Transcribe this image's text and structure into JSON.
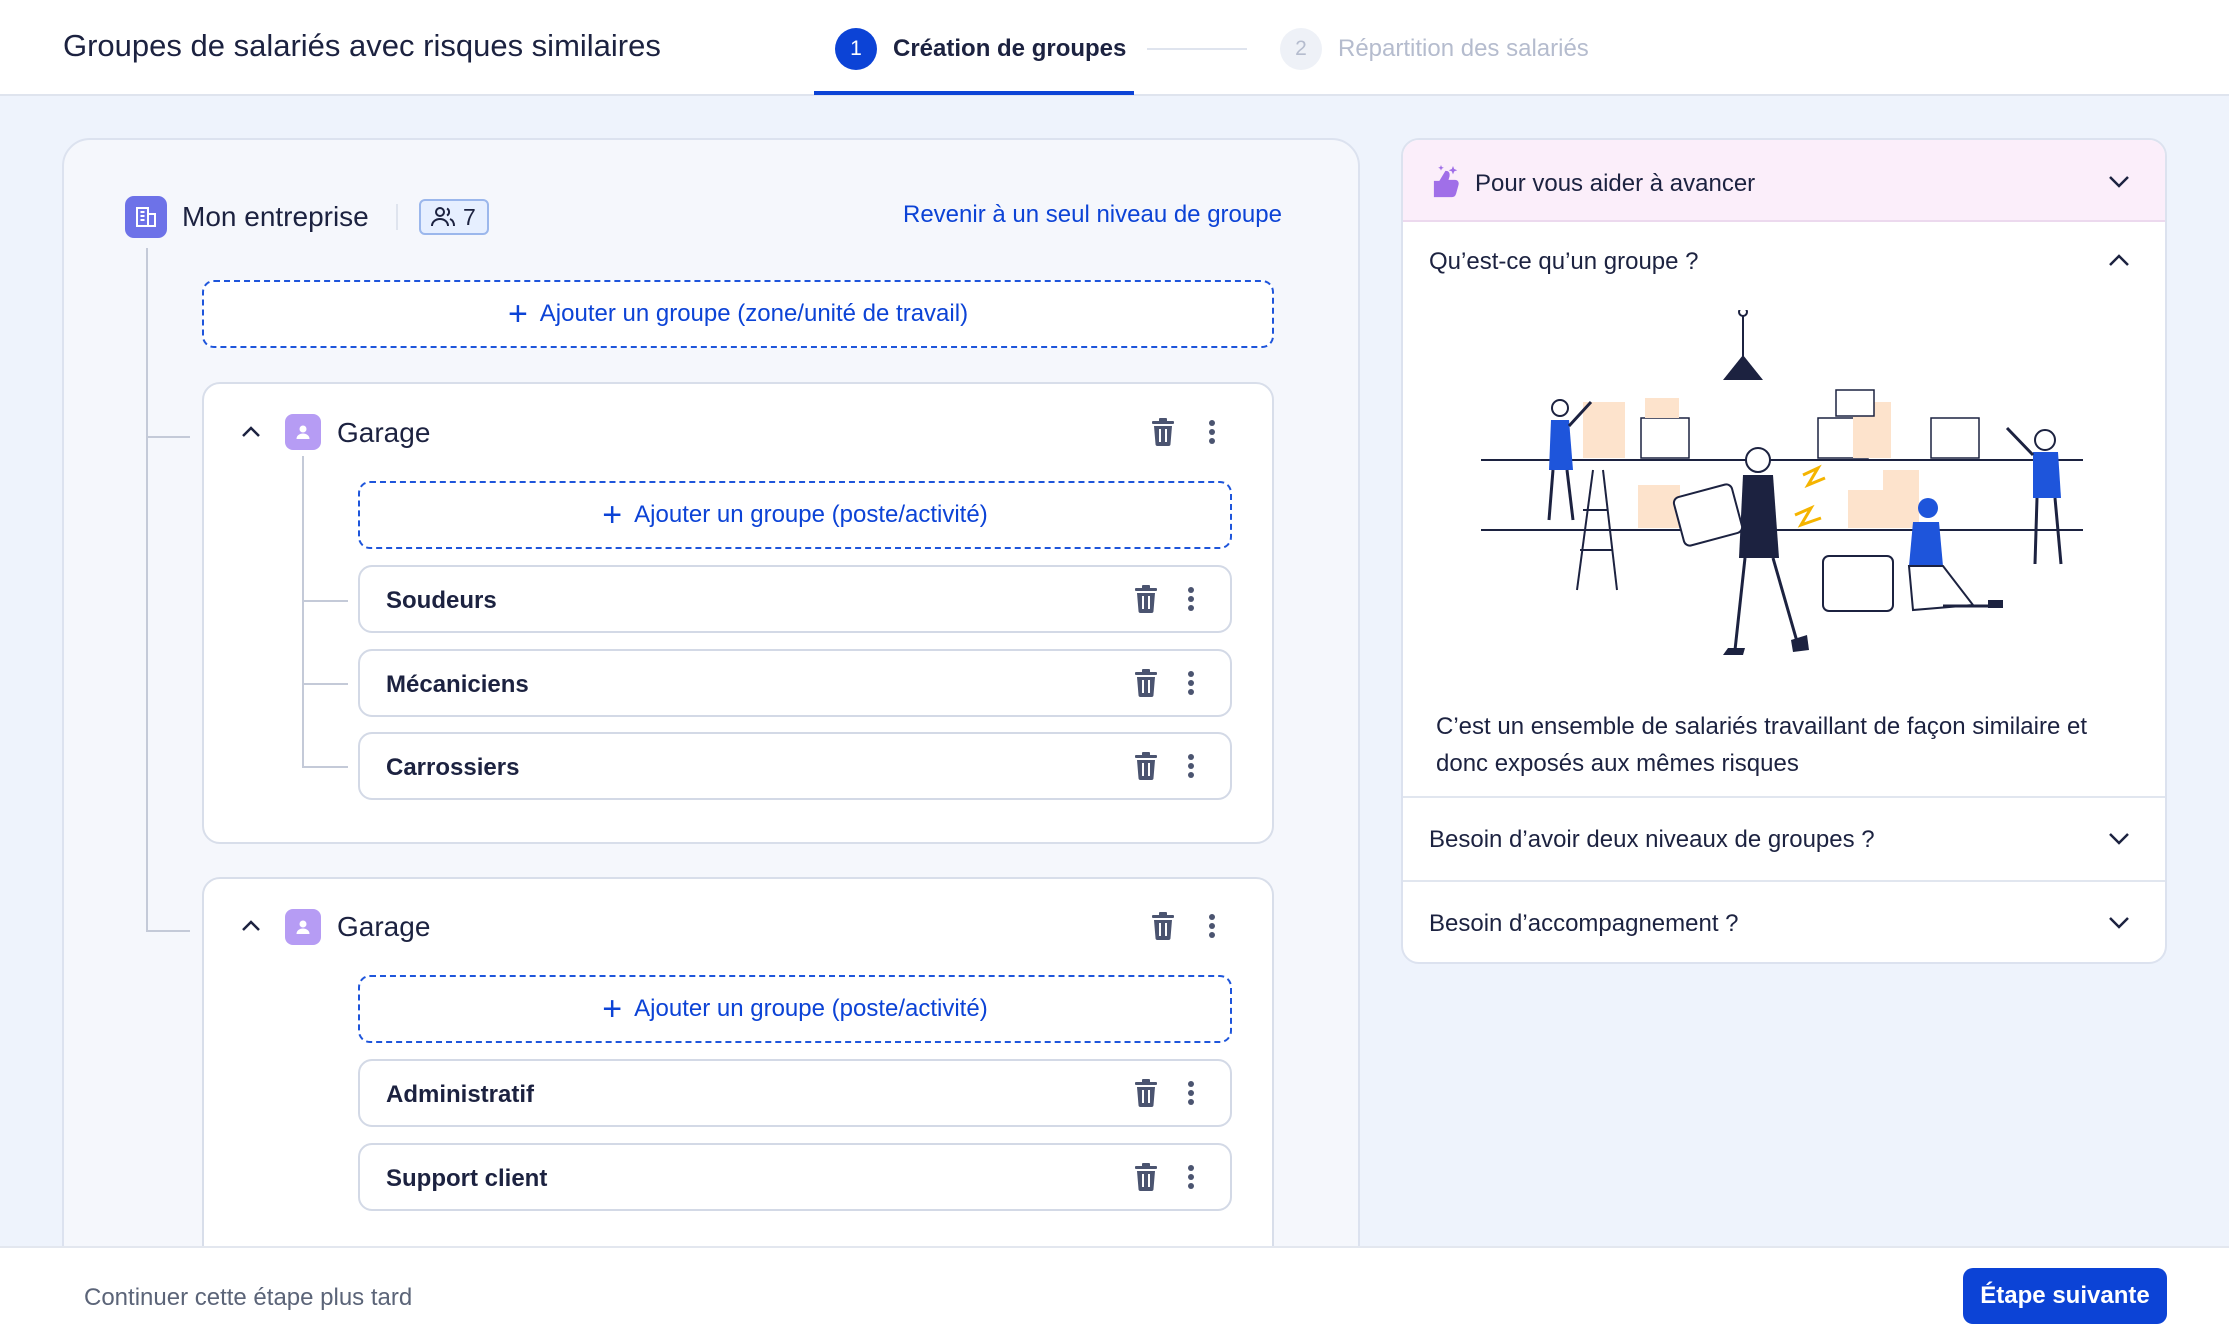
{
  "header": {
    "title": "Groupes de salariés avec risques similaires",
    "steps": [
      {
        "number": "1",
        "label": "Création de groupes",
        "active": true
      },
      {
        "number": "2",
        "label": "Répartition des salariés",
        "active": false
      }
    ]
  },
  "enterprise": {
    "name": "Mon entreprise",
    "employee_count": "7",
    "revert_link": "Revenir à un seul niveau de groupe",
    "add_group_label": "Ajouter un groupe (zone/unité de travail)"
  },
  "groups": [
    {
      "title": "Garage",
      "add_label": "Ajouter un groupe (poste/activité)",
      "items": [
        {
          "label": "Soudeurs"
        },
        {
          "label": "Mécaniciens"
        },
        {
          "label": "Carrossiers"
        }
      ]
    },
    {
      "title": "Garage",
      "add_label": "Ajouter un groupe (poste/activité)",
      "items": [
        {
          "label": "Administratif"
        },
        {
          "label": "Support client"
        }
      ]
    }
  ],
  "help": {
    "header": "Pour vous aider à avancer",
    "accordions": [
      {
        "title": "Qu’est-ce qu’un groupe ?",
        "expanded": true,
        "text": "C’est un ensemble de salariés travaillant de façon similaire et donc exposés aux mêmes risques"
      },
      {
        "title": "Besoin d’avoir deux niveaux de groupes ?",
        "expanded": false
      },
      {
        "title": "Besoin d’accompagnement ?",
        "expanded": false
      }
    ]
  },
  "footer": {
    "later_link": "Continuer cette étape plus tard",
    "next_button": "Étape suivante"
  },
  "colors": {
    "primary": "#0c43d6",
    "background": "#eef3fc",
    "group_icon": "#b69cf4",
    "enterprise_icon": "#6d72e8",
    "help_header_bg": "#fbeefa"
  }
}
